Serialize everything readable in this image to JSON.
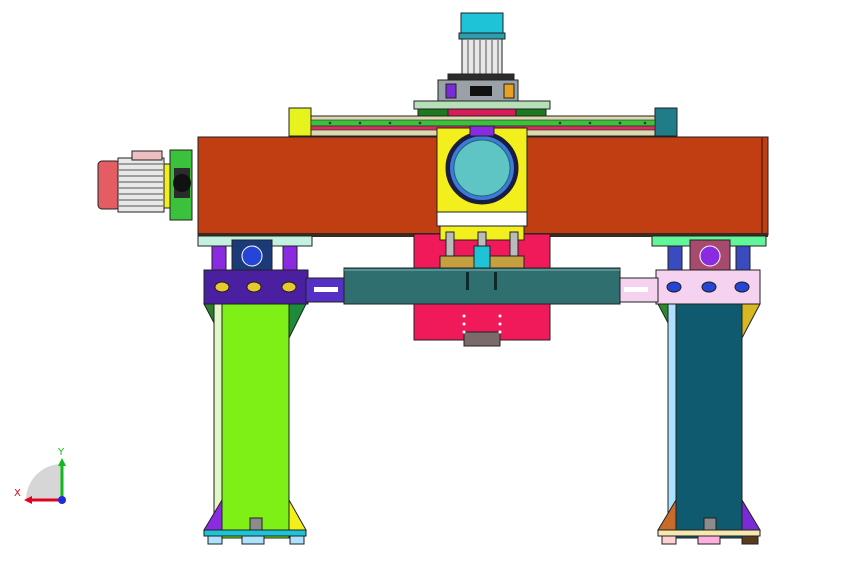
{
  "triad": {
    "x_label": "X",
    "y_label": "Y",
    "x_color": "#e1001e",
    "y_color": "#12b81c",
    "z_color": "#1f2bd8"
  },
  "parts": {
    "gantry_beam_color": "#c13d12",
    "rail_color": "#3cc13c",
    "left_column_color": "#7ef016",
    "right_column_color": "#0f5a6e",
    "spindle_head_color": "#f0195a",
    "motor_color": "#1ec3d8",
    "side_motor_color": "#e35d62"
  }
}
